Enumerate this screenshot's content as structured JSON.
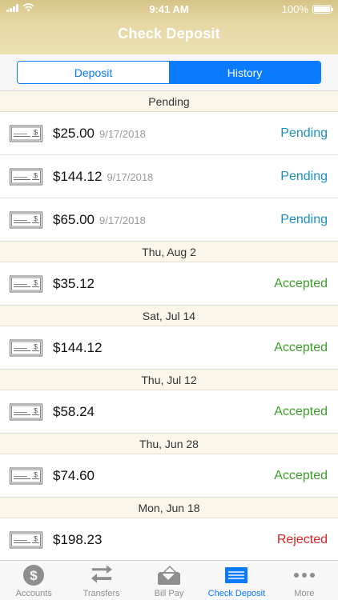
{
  "status_bar": {
    "time": "9:41 AM",
    "battery": "100%"
  },
  "nav": {
    "title": "Check Deposit"
  },
  "segmented": {
    "deposit_label": "Deposit",
    "history_label": "History",
    "selected": "History"
  },
  "colors": {
    "pending": "#1a8fc2",
    "accepted": "#3a9e2a",
    "rejected": "#e02020",
    "accent": "#0a7aff"
  },
  "sections": [
    {
      "header": "Pending",
      "rows": [
        {
          "amount": "$25.00",
          "date": "9/17/2018",
          "status": "Pending",
          "status_type": "pending"
        },
        {
          "amount": "$144.12",
          "date": "9/17/2018",
          "status": "Pending",
          "status_type": "pending"
        },
        {
          "amount": "$65.00",
          "date": "9/17/2018",
          "status": "Pending",
          "status_type": "pending"
        }
      ]
    },
    {
      "header": "Thu, Aug 2",
      "rows": [
        {
          "amount": "$35.12",
          "date": "",
          "status": "Accepted",
          "status_type": "accepted"
        }
      ]
    },
    {
      "header": "Sat, Jul 14",
      "rows": [
        {
          "amount": "$144.12",
          "date": "",
          "status": "Accepted",
          "status_type": "accepted"
        }
      ]
    },
    {
      "header": "Thu, Jul 12",
      "rows": [
        {
          "amount": "$58.24",
          "date": "",
          "status": "Accepted",
          "status_type": "accepted"
        }
      ]
    },
    {
      "header": "Thu, Jun 28",
      "rows": [
        {
          "amount": "$74.60",
          "date": "",
          "status": "Accepted",
          "status_type": "accepted"
        }
      ]
    },
    {
      "header": "Mon, Jun 18",
      "rows": [
        {
          "amount": "$198.23",
          "date": "",
          "status": "Rejected",
          "status_type": "rejected"
        }
      ]
    }
  ],
  "tabbar": {
    "items": [
      {
        "label": "Accounts",
        "icon": "dollar-coin-icon",
        "active": false
      },
      {
        "label": "Transfers",
        "icon": "transfer-arrows-icon",
        "active": false
      },
      {
        "label": "Bill Pay",
        "icon": "bill-pay-icon",
        "active": false
      },
      {
        "label": "Check Deposit",
        "icon": "check-deposit-icon",
        "active": true
      },
      {
        "label": "More",
        "icon": "more-dots-icon",
        "active": false
      }
    ]
  }
}
